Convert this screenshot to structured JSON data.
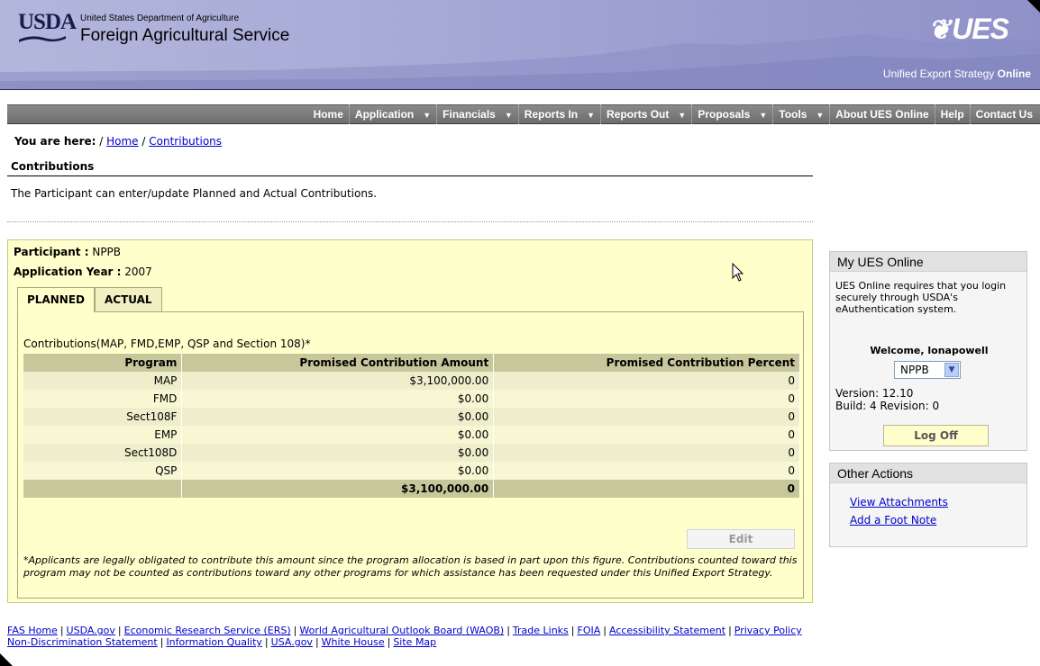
{
  "header": {
    "usda_logo": "USDA",
    "department": "United States Department of Agriculture",
    "agency": "Foreign Agricultural Service",
    "ues_logo": "UES",
    "tagline_prefix": "Unified Export Strategy",
    "tagline_suffix": "Online"
  },
  "nav": {
    "items": [
      {
        "label": "Home",
        "dropdown": false
      },
      {
        "label": "Application",
        "dropdown": true
      },
      {
        "label": "Financials",
        "dropdown": true
      },
      {
        "label": "Reports In",
        "dropdown": true
      },
      {
        "label": "Reports Out",
        "dropdown": true
      },
      {
        "label": "Proposals",
        "dropdown": true
      },
      {
        "label": "Tools",
        "dropdown": true
      },
      {
        "label": "About UES Online",
        "dropdown": false
      },
      {
        "label": "Help",
        "dropdown": false
      },
      {
        "label": "Contact Us",
        "dropdown": false
      }
    ]
  },
  "breadcrumb": {
    "prefix": "You are here:",
    "sep": "/",
    "home": "Home",
    "current": "Contributions"
  },
  "page": {
    "title": "Contributions",
    "description": "The Participant can enter/update Planned and Actual Contributions."
  },
  "main": {
    "participant_label": "Participant :",
    "participant_value": "NPPB",
    "year_label": "Application Year :",
    "year_value": "2007",
    "tabs": [
      {
        "label": "PLANNED",
        "active": true
      },
      {
        "label": "ACTUAL",
        "active": false
      }
    ],
    "table_caption": "Contributions(MAP, FMD,EMP, QSP and Section 108)*",
    "columns": [
      "Program",
      "Promised Contribution Amount",
      "Promised Contribution Percent"
    ],
    "rows": [
      [
        "MAP",
        "$3,100,000.00",
        "0"
      ],
      [
        "FMD",
        "$0.00",
        "0"
      ],
      [
        "Sect108F",
        "$0.00",
        "0"
      ],
      [
        "EMP",
        "$0.00",
        "0"
      ],
      [
        "Sect108D",
        "$0.00",
        "0"
      ],
      [
        "QSP",
        "$0.00",
        "0"
      ]
    ],
    "total_row": [
      "",
      "$3,100,000.00",
      "0"
    ],
    "edit_label": "Edit",
    "footnote": "*Applicants are legally obligated to contribute this amount since the program allocation is based in part upon this figure. Contributions counted toward this program may not be counted as contributions toward any other programs for which assistance has been requested under this Unified Export Strategy."
  },
  "sidebar": {
    "my_ues": {
      "title": "My UES Online",
      "message": "UES Online requires that you login securely through USDA's eAuthentication system.",
      "welcome": "Welcome, lonapowell",
      "select_value": "NPPB",
      "version": "Version: 12.10",
      "build": "Build: 4 Revision: 0",
      "logoff_label": "Log Off"
    },
    "other_actions": {
      "title": "Other Actions",
      "links": [
        "View Attachments",
        "Add a Foot Note"
      ]
    }
  },
  "footer": {
    "row1": [
      "FAS Home",
      "USDA.gov",
      "Economic Research Service (ERS)",
      "World Agricultural Outlook Board (WAOB)",
      "Trade Links",
      "FOIA",
      "Accessibility Statement",
      "Privacy Policy"
    ],
    "row2": [
      "Non-Discrimination Statement",
      "Information Quality",
      "USA.gov",
      "White House",
      "Site Map"
    ]
  }
}
